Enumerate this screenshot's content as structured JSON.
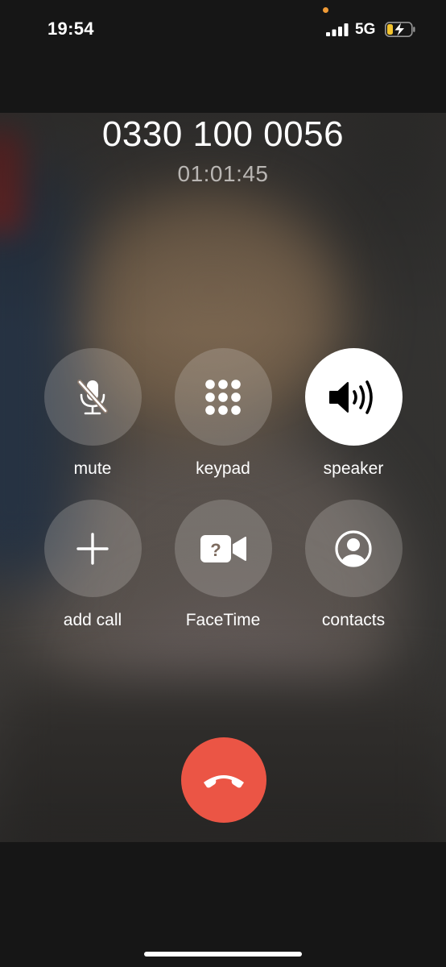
{
  "status_bar": {
    "time": "19:54",
    "network": "5G",
    "signal_bars": 4,
    "battery_charging": true,
    "mic_indicator_color": "#f09a36"
  },
  "call": {
    "number": "0330 100 0056",
    "duration": "01:01:45"
  },
  "controls": [
    {
      "label": "mute",
      "icon": "mic-slash-icon",
      "active": false
    },
    {
      "label": "keypad",
      "icon": "keypad-grid-icon",
      "active": false
    },
    {
      "label": "speaker",
      "icon": "speaker-wave-icon",
      "active": true
    },
    {
      "label": "add call",
      "icon": "plus-icon",
      "active": false
    },
    {
      "label": "FaceTime",
      "icon": "facetime-video-icon",
      "active": false
    },
    {
      "label": "contacts",
      "icon": "person-circle-icon",
      "active": false
    }
  ],
  "end_call": {
    "icon": "phone-down-icon",
    "color": "#eb5545"
  },
  "colors": {
    "background": "#161616",
    "button_fill": "rgba(210,205,200,0.26)",
    "active_button": "#ffffff",
    "duration_text": "#b9b6b3"
  }
}
